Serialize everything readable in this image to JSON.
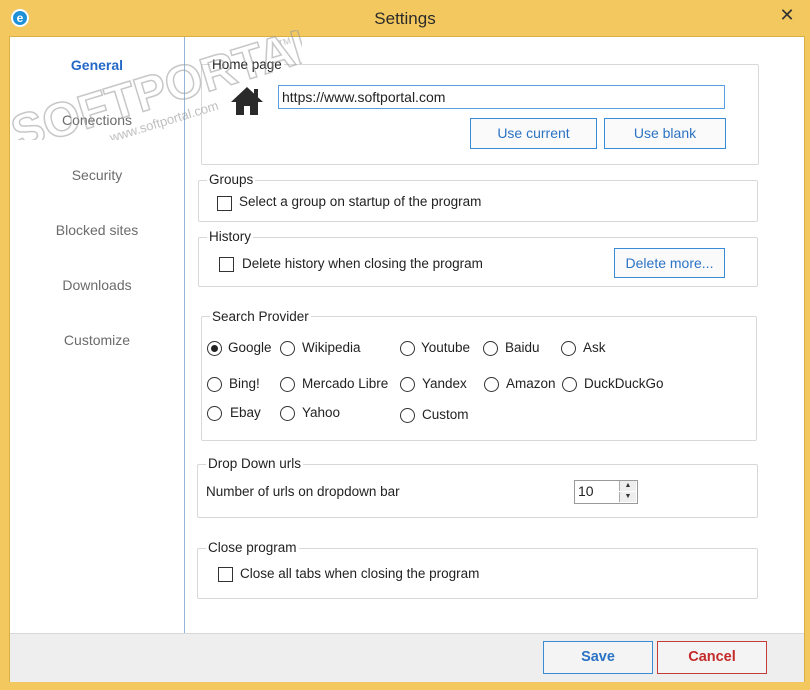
{
  "window": {
    "title": "Settings",
    "close_glyph": "✕",
    "app_icon": "e"
  },
  "watermark": {
    "brand": "SOFTPORTAL",
    "url": "www.softportal.com",
    "tm": "TM"
  },
  "sidebar": {
    "items": [
      {
        "label": "General",
        "active": true
      },
      {
        "label": "Conections",
        "active": false
      },
      {
        "label": "Security",
        "active": false
      },
      {
        "label": "Blocked sites",
        "active": false
      },
      {
        "label": "Downloads",
        "active": false
      },
      {
        "label": "Customize",
        "active": false
      }
    ]
  },
  "home_page": {
    "label": "Home page",
    "url_value": "https://www.softportal.com",
    "use_current_label": "Use current",
    "use_blank_label": "Use blank"
  },
  "groups": {
    "label": "Groups",
    "startup_checkbox_label": "Select a group on startup of the program",
    "startup_checked": false
  },
  "history": {
    "label": "History",
    "delete_checkbox_label": "Delete history when closing the program",
    "delete_checked": false,
    "delete_more_label": "Delete more..."
  },
  "search_provider": {
    "label": "Search Provider",
    "selected": "Google",
    "options": [
      "Google",
      "Wikipedia",
      "Youtube",
      "Baidu",
      "Ask",
      "Bing!",
      "Mercado Libre",
      "Yandex",
      "Amazon",
      "DuckDuckGo",
      "Ebay",
      "Yahoo",
      "Custom"
    ]
  },
  "dropdown_urls": {
    "label": "Drop Down urls",
    "count_label": "Number of urls on dropdown bar",
    "count_value": "10"
  },
  "close_program": {
    "label": "Close program",
    "close_tabs_label": "Close all tabs when closing the program",
    "close_tabs_checked": false
  },
  "footer": {
    "save_label": "Save",
    "cancel_label": "Cancel"
  }
}
